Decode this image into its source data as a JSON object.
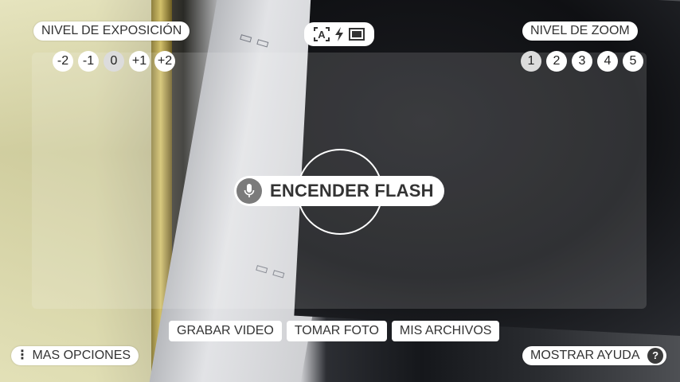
{
  "exposure": {
    "title": "NIVEL DE EXPOSICIÓN",
    "levels": [
      "-2",
      "-1",
      "0",
      "+1",
      "+2"
    ],
    "selected": "0"
  },
  "zoom": {
    "title": "NIVEL DE ZOOM",
    "levels": [
      "1",
      "2",
      "3",
      "4",
      "5"
    ],
    "selected": "1"
  },
  "modes": {
    "icons": [
      "auto-mode-icon",
      "flash-icon",
      "aspect-ratio-icon"
    ],
    "auto_mode_glyph": "A"
  },
  "voice": {
    "command": "ENCENDER FLASH",
    "icon": "microphone-icon"
  },
  "bottom": {
    "video_label": "GRABAR VIDEO",
    "photo_label": "TOMAR FOTO",
    "files_label": "MIS ARCHIVOS"
  },
  "more": {
    "label": "MAS OPCIONES",
    "icon": "more-vertical-icon",
    "icon_glyph": "⋮"
  },
  "help": {
    "label": "MOSTRAR AYUDA",
    "icon": "help-icon",
    "icon_glyph": "?"
  },
  "colors": {
    "pill_bg": "#ffffff",
    "text": "#333333",
    "mic_bg": "#7b7b7b"
  }
}
